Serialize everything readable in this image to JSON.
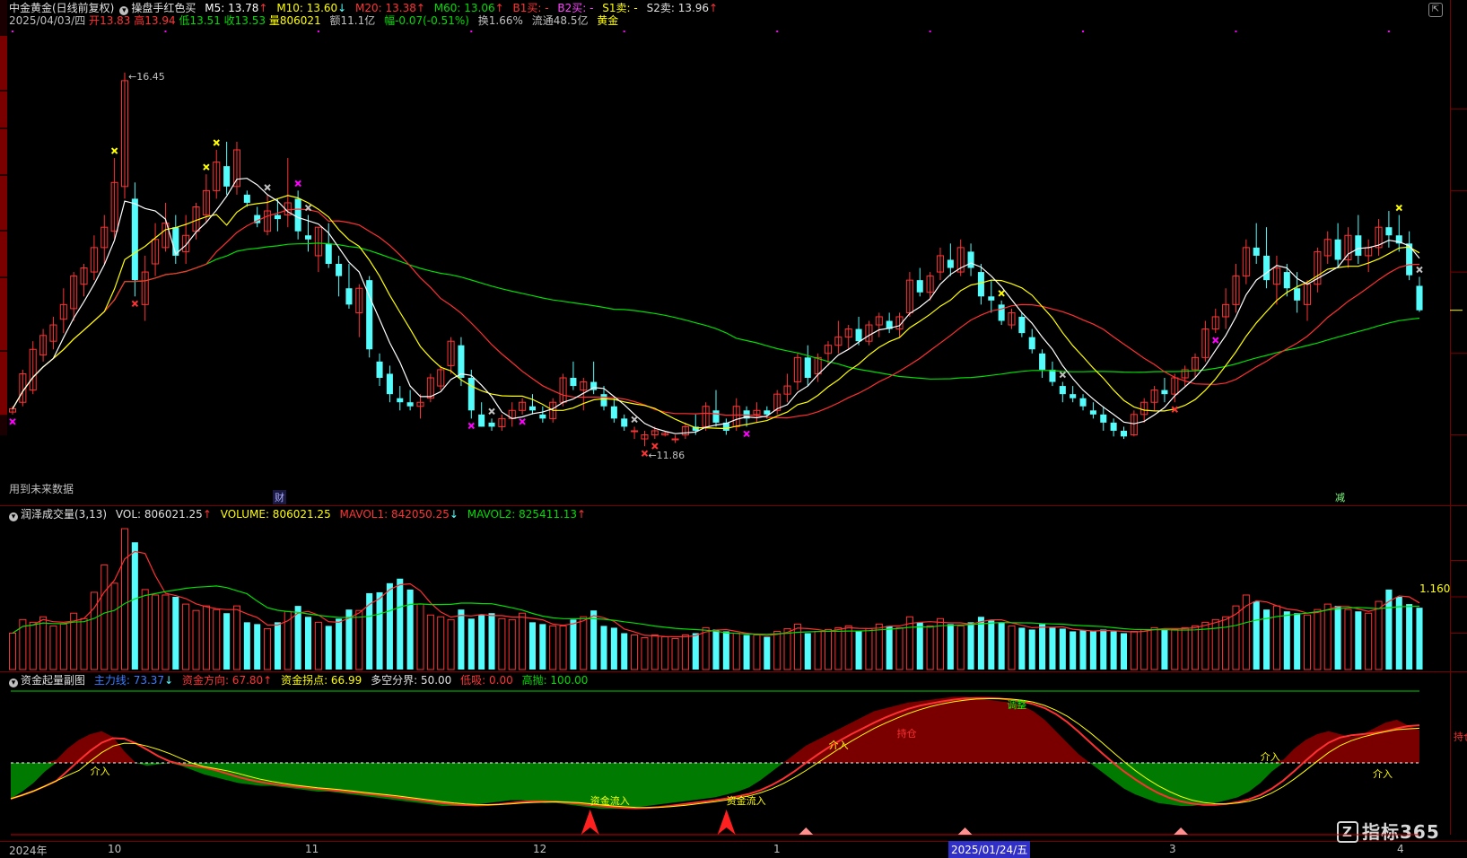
{
  "header": {
    "stock_name": "中金黄金(日线前复权)",
    "indicator_name": "操盘手红色买",
    "m5_label": "M5: 13.78",
    "m10_label": "M10: 13.60",
    "m20_label": "M20: 13.38",
    "m60_label": "M60: 13.06",
    "b1_label": "B1买: -",
    "b2_label": "B2买: -",
    "s1_label": "S1卖: -",
    "s2_label": "S2卖: 13.96",
    "up_arrow": "↑",
    "down_arrow": "↓",
    "date": "2025/04/03/四",
    "open_label": "开",
    "open_value": "13.83",
    "high_label": "高",
    "high_value": "13.94",
    "low_label": "低",
    "low_value": "13.51",
    "close_label": "收",
    "close_value": "13.53",
    "volume_label": "量",
    "volume_value": "806021",
    "amount": "额11.1亿",
    "change": "幅-0.07(-0.51%)",
    "turnover": "换1.66%",
    "float_cap": "流通48.5亿",
    "sector": "黄金"
  },
  "main_chart": {
    "high_annotation": "16.45",
    "low_annotation": "11.86",
    "future_data_note": "用到未来数据",
    "finance_marker": "财",
    "reduce_marker": "减",
    "price_range": [
      11.3,
      16.9
    ],
    "colors": {
      "up": "#ff3333",
      "down": "#54fcfc",
      "m5": "#ffffff",
      "m10": "#ffff00",
      "m20": "#ff3030",
      "m60": "#00dd00"
    }
  },
  "volume_panel": {
    "title": "润泽成交量(3,13)",
    "vol_label": "VOL: 806021.25",
    "volume_label": "VOLUME: 806021.25",
    "mavol1_label": "MAVOL1: 842050.25",
    "mavol2_label": "MAVOL2: 825411.13",
    "scale_label": "1.160"
  },
  "fund_panel": {
    "title": "资金起量副图",
    "main_force_label": "主力线: 73.37",
    "direction_label": "资金方向: 67.80",
    "turning_label": "资金拐点: 66.99",
    "divide_label": "多空分界: 50.00",
    "low_label": "低吸: 0.00",
    "high_label": "高抛: 100.00",
    "annotations": {
      "jieru_1": "介入",
      "jieru_2": "介入",
      "jieru_3": "介入",
      "jieru_4": "介入",
      "inflow_1": "资金流入",
      "inflow_2": "资金流入",
      "hold_1": "持仓",
      "hold_2": "持仓",
      "adjust": "调整"
    }
  },
  "time_axis": {
    "labels": [
      "2024年",
      "10",
      "11",
      "12",
      "1",
      "3",
      "4"
    ],
    "highlight_date": "2025/01/24/五"
  },
  "chart_data": [
    {
      "type": "candlestick",
      "title": "中金黄金(日线前复权)",
      "ylim": [
        11.3,
        16.9
      ],
      "ohlc": [
        [
          12.28,
          12.35,
          12.25,
          12.32
        ],
        [
          12.4,
          12.8,
          12.35,
          12.75
        ],
        [
          12.55,
          13.15,
          12.5,
          13.05
        ],
        [
          12.98,
          13.3,
          12.9,
          13.22
        ],
        [
          13.15,
          13.45,
          13.05,
          13.35
        ],
        [
          13.42,
          13.8,
          13.25,
          13.6
        ],
        [
          13.55,
          14.0,
          13.4,
          13.95
        ],
        [
          13.85,
          14.1,
          13.7,
          14.05
        ],
        [
          14.0,
          14.45,
          13.9,
          14.3
        ],
        [
          14.3,
          14.7,
          14.1,
          14.55
        ],
        [
          14.5,
          15.4,
          14.4,
          15.1
        ],
        [
          15.05,
          16.45,
          14.9,
          16.35
        ],
        [
          14.9,
          15.1,
          13.7,
          13.9
        ],
        [
          13.6,
          14.2,
          13.4,
          14.0
        ],
        [
          14.1,
          14.6,
          13.95,
          14.4
        ],
        [
          14.3,
          14.85,
          14.25,
          14.6
        ],
        [
          14.55,
          14.7,
          14.1,
          14.2
        ],
        [
          14.25,
          14.7,
          14.1,
          14.45
        ],
        [
          14.5,
          14.85,
          14.4,
          14.8
        ],
        [
          14.7,
          15.2,
          14.6,
          15.0
        ],
        [
          15.0,
          15.5,
          14.9,
          15.35
        ],
        [
          15.3,
          15.6,
          14.95,
          15.05
        ],
        [
          15.05,
          15.6,
          14.95,
          15.5
        ],
        [
          14.95,
          15.0,
          14.8,
          14.85
        ],
        [
          14.7,
          14.8,
          14.55,
          14.6
        ],
        [
          14.5,
          14.95,
          14.45,
          14.75
        ],
        [
          14.7,
          14.9,
          14.5,
          14.65
        ],
        [
          14.7,
          15.4,
          14.55,
          14.85
        ],
        [
          14.9,
          15.0,
          14.4,
          14.5
        ],
        [
          14.45,
          14.7,
          14.25,
          14.4
        ],
        [
          14.2,
          14.55,
          14.0,
          14.55
        ],
        [
          14.35,
          14.6,
          14.05,
          14.1
        ],
        [
          14.1,
          14.2,
          13.7,
          13.95
        ],
        [
          13.8,
          14.1,
          13.55,
          13.6
        ],
        [
          13.5,
          13.85,
          13.2,
          13.8
        ],
        [
          13.9,
          13.95,
          12.95,
          13.05
        ],
        [
          12.9,
          13.0,
          12.6,
          12.7
        ],
        [
          12.75,
          12.85,
          12.4,
          12.5
        ],
        [
          12.45,
          12.6,
          12.3,
          12.4
        ],
        [
          12.4,
          12.55,
          12.3,
          12.35
        ],
        [
          12.35,
          12.5,
          12.2,
          12.4
        ],
        [
          12.45,
          12.75,
          12.4,
          12.7
        ],
        [
          12.6,
          12.85,
          12.55,
          12.8
        ],
        [
          12.85,
          13.2,
          12.75,
          13.15
        ],
        [
          13.1,
          13.2,
          12.6,
          12.7
        ],
        [
          12.7,
          12.8,
          12.2,
          12.3
        ],
        [
          12.25,
          12.4,
          12.1,
          12.1
        ],
        [
          12.15,
          12.2,
          12.05,
          12.1
        ],
        [
          12.1,
          12.25,
          12.05,
          12.2
        ],
        [
          12.2,
          12.4,
          12.1,
          12.3
        ],
        [
          12.3,
          12.45,
          12.25,
          12.4
        ],
        [
          12.35,
          12.5,
          12.25,
          12.3
        ],
        [
          12.25,
          12.35,
          12.15,
          12.2
        ],
        [
          12.2,
          12.45,
          12.15,
          12.4
        ],
        [
          12.4,
          12.75,
          12.35,
          12.7
        ],
        [
          12.7,
          12.9,
          12.55,
          12.6
        ],
        [
          12.55,
          12.7,
          12.3,
          12.65
        ],
        [
          12.65,
          12.9,
          12.5,
          12.55
        ],
        [
          12.5,
          12.6,
          12.3,
          12.35
        ],
        [
          12.35,
          12.45,
          12.15,
          12.2
        ],
        [
          12.2,
          12.25,
          12.05,
          12.1
        ],
        [
          12.05,
          12.1,
          11.95,
          12.05
        ],
        [
          11.95,
          12.05,
          11.86,
          12.0
        ],
        [
          12.0,
          12.1,
          11.95,
          12.05
        ],
        [
          12.0,
          12.05,
          11.98,
          12.02
        ],
        [
          11.95,
          12.0,
          11.9,
          11.95
        ],
        [
          12.0,
          12.15,
          11.95,
          12.1
        ],
        [
          12.1,
          12.25,
          12.0,
          12.05
        ],
        [
          12.1,
          12.4,
          12.05,
          12.35
        ],
        [
          12.3,
          12.55,
          12.1,
          12.15
        ],
        [
          12.15,
          12.2,
          12.0,
          12.05
        ],
        [
          12.1,
          12.45,
          12.05,
          12.35
        ],
        [
          12.3,
          12.35,
          12.1,
          12.2
        ],
        [
          12.25,
          12.4,
          12.15,
          12.3
        ],
        [
          12.3,
          12.35,
          12.2,
          12.25
        ],
        [
          12.3,
          12.55,
          12.25,
          12.5
        ],
        [
          12.5,
          12.75,
          12.4,
          12.6
        ],
        [
          12.65,
          13.0,
          12.55,
          12.95
        ],
        [
          12.95,
          13.1,
          12.6,
          12.7
        ],
        [
          12.75,
          13.0,
          12.65,
          12.95
        ],
        [
          13.0,
          13.15,
          12.85,
          13.1
        ],
        [
          13.1,
          13.4,
          13.0,
          13.2
        ],
        [
          13.2,
          13.35,
          13.05,
          13.3
        ],
        [
          13.3,
          13.45,
          13.1,
          13.15
        ],
        [
          13.15,
          13.4,
          13.1,
          13.35
        ],
        [
          13.35,
          13.5,
          13.2,
          13.45
        ],
        [
          13.4,
          13.5,
          13.25,
          13.3
        ],
        [
          13.3,
          13.5,
          13.2,
          13.45
        ],
        [
          13.5,
          14.0,
          13.45,
          13.9
        ],
        [
          13.9,
          14.05,
          13.7,
          13.75
        ],
        [
          13.75,
          14.0,
          13.65,
          13.95
        ],
        [
          14.0,
          14.3,
          13.9,
          14.2
        ],
        [
          14.15,
          14.35,
          13.95,
          14.05
        ],
        [
          14.0,
          14.4,
          13.95,
          14.3
        ],
        [
          14.25,
          14.35,
          13.95,
          14.05
        ],
        [
          14.0,
          14.1,
          13.6,
          13.7
        ],
        [
          13.7,
          13.9,
          13.5,
          13.65
        ],
        [
          13.6,
          13.65,
          13.35,
          13.4
        ],
        [
          13.35,
          13.55,
          13.3,
          13.5
        ],
        [
          13.45,
          13.5,
          13.2,
          13.25
        ],
        [
          13.2,
          13.3,
          13.0,
          13.05
        ],
        [
          13.0,
          13.05,
          12.7,
          12.8
        ],
        [
          12.8,
          12.9,
          12.6,
          12.65
        ],
        [
          12.6,
          12.65,
          12.4,
          12.5
        ],
        [
          12.5,
          12.6,
          12.4,
          12.45
        ],
        [
          12.45,
          12.5,
          12.3,
          12.35
        ],
        [
          12.3,
          12.4,
          12.2,
          12.25
        ],
        [
          12.25,
          12.35,
          12.05,
          12.15
        ],
        [
          12.15,
          12.2,
          11.98,
          12.05
        ],
        [
          12.05,
          12.1,
          11.95,
          11.98
        ],
        [
          12.0,
          12.3,
          11.98,
          12.25
        ],
        [
          12.25,
          12.45,
          12.15,
          12.4
        ],
        [
          12.4,
          12.6,
          12.3,
          12.55
        ],
        [
          12.55,
          12.7,
          12.4,
          12.5
        ],
        [
          12.5,
          12.75,
          12.4,
          12.7
        ],
        [
          12.7,
          12.85,
          12.6,
          12.8
        ],
        [
          12.8,
          13.0,
          12.7,
          12.95
        ],
        [
          12.95,
          13.4,
          12.9,
          13.3
        ],
        [
          13.3,
          13.55,
          13.25,
          13.45
        ],
        [
          13.45,
          13.8,
          13.3,
          13.6
        ],
        [
          13.6,
          14.1,
          13.5,
          13.95
        ],
        [
          13.95,
          14.4,
          13.85,
          14.3
        ],
        [
          14.3,
          14.6,
          14.1,
          14.2
        ],
        [
          14.2,
          14.55,
          13.8,
          13.9
        ],
        [
          13.85,
          14.2,
          13.6,
          14.05
        ],
        [
          14.0,
          14.1,
          13.7,
          13.8
        ],
        [
          13.8,
          14.0,
          13.5,
          13.65
        ],
        [
          13.6,
          13.9,
          13.4,
          13.85
        ],
        [
          13.85,
          14.3,
          13.75,
          14.25
        ],
        [
          14.2,
          14.5,
          14.1,
          14.4
        ],
        [
          14.4,
          14.6,
          14.05,
          14.15
        ],
        [
          14.15,
          14.55,
          14.05,
          14.45
        ],
        [
          14.45,
          14.7,
          14.1,
          14.2
        ],
        [
          14.2,
          14.4,
          14.0,
          14.3
        ],
        [
          14.3,
          14.65,
          14.2,
          14.55
        ],
        [
          14.55,
          14.75,
          14.3,
          14.45
        ],
        [
          14.45,
          14.7,
          14.25,
          14.35
        ],
        [
          14.35,
          14.5,
          13.9,
          13.96
        ],
        [
          13.83,
          13.94,
          13.51,
          13.53
        ]
      ],
      "ma": {
        "M5": 13.78,
        "M10": 13.6,
        "M20": 13.38,
        "M60": 13.06
      }
    },
    {
      "type": "bar",
      "title": "润泽成交量(3,13)",
      "volume": [
        0.4,
        0.55,
        0.52,
        0.58,
        0.48,
        0.5,
        0.62,
        0.56,
        0.85,
        1.15,
        0.95,
        1.55,
        1.4,
        0.88,
        0.82,
        0.82,
        0.8,
        0.72,
        0.65,
        0.7,
        0.66,
        0.62,
        0.7,
        0.52,
        0.5,
        0.45,
        0.52,
        0.64,
        0.7,
        0.58,
        0.52,
        0.48,
        0.56,
        0.66,
        0.65,
        0.84,
        0.85,
        0.95,
        1.0,
        0.88,
        0.72,
        0.6,
        0.58,
        0.55,
        0.66,
        0.56,
        0.6,
        0.62,
        0.56,
        0.55,
        0.62,
        0.52,
        0.5,
        0.48,
        0.48,
        0.55,
        0.58,
        0.65,
        0.48,
        0.46,
        0.4,
        0.38,
        0.35,
        0.38,
        0.36,
        0.34,
        0.38,
        0.4,
        0.46,
        0.44,
        0.42,
        0.4,
        0.38,
        0.38,
        0.36,
        0.42,
        0.45,
        0.5,
        0.4,
        0.42,
        0.44,
        0.46,
        0.48,
        0.42,
        0.45,
        0.5,
        0.48,
        0.46,
        0.58,
        0.52,
        0.48,
        0.56,
        0.5,
        0.48,
        0.52,
        0.58,
        0.54,
        0.52,
        0.48,
        0.46,
        0.44,
        0.5,
        0.46,
        0.45,
        0.42,
        0.43,
        0.42,
        0.44,
        0.42,
        0.4,
        0.42,
        0.44,
        0.46,
        0.45,
        0.44,
        0.46,
        0.48,
        0.52,
        0.55,
        0.58,
        0.7,
        0.82,
        0.75,
        0.66,
        0.7,
        0.64,
        0.62,
        0.6,
        0.66,
        0.72,
        0.7,
        0.66,
        0.64,
        0.62,
        0.75,
        0.88,
        0.8,
        0.72,
        0.68
      ],
      "mavol1_last": 842050.25,
      "mavol2_last": 825411.13
    },
    {
      "type": "area",
      "title": "资金起量副图",
      "series": [
        {
          "name": "主力线",
          "last": 73.37
        },
        {
          "name": "资金方向",
          "last": 67.8
        },
        {
          "name": "资金拐点",
          "last": 66.99
        }
      ],
      "ylim": [
        0,
        100
      ],
      "divide": 50,
      "low": 0,
      "high": 100,
      "main_force": [
        25,
        30,
        36,
        44,
        52,
        60,
        66,
        70,
        72,
        68,
        58,
        50,
        48,
        49,
        50,
        48,
        45,
        42,
        40,
        38,
        36,
        35,
        34,
        34,
        33,
        32,
        31,
        30,
        30,
        29,
        28,
        27,
        26,
        25,
        24,
        23,
        22,
        21,
        20,
        20,
        20,
        21,
        22,
        23,
        24,
        24,
        23,
        22,
        22,
        21,
        20,
        19,
        18,
        18,
        18,
        19,
        20,
        21,
        22,
        23,
        24,
        25,
        26,
        28,
        30,
        33,
        38,
        44,
        50,
        56,
        62,
        66,
        70,
        74,
        78,
        82,
        86,
        88,
        90,
        92,
        93,
        94,
        95,
        96,
        96,
        95,
        94,
        93,
        92,
        90,
        86,
        80,
        72,
        64,
        56,
        50,
        44,
        38,
        32,
        28,
        25,
        22,
        21,
        20,
        20,
        21,
        22,
        24,
        26,
        30,
        36,
        44,
        52,
        60,
        66,
        70,
        72,
        70,
        68,
        70,
        74,
        78,
        80,
        76,
        73
      ]
    }
  ]
}
